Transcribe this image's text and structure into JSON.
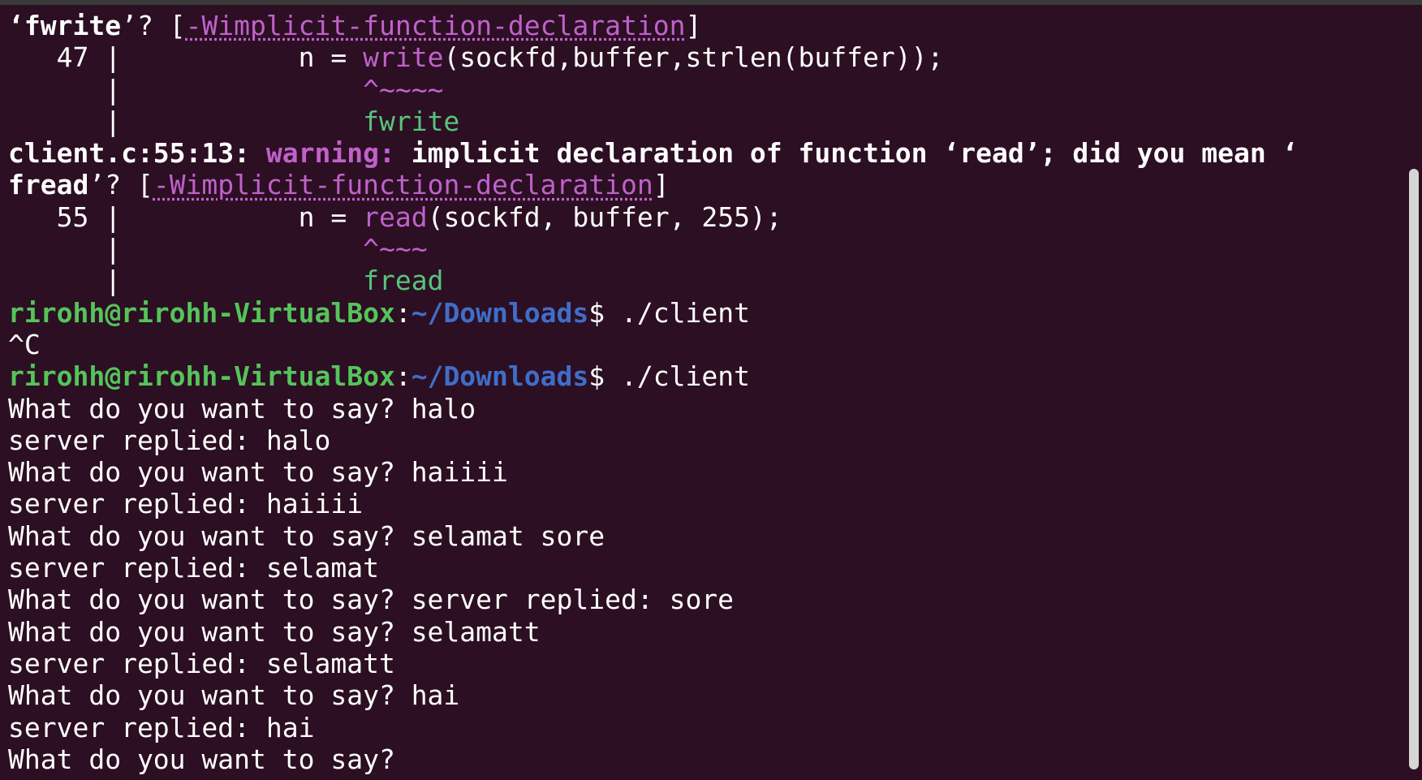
{
  "terminal": {
    "colors": {
      "background": "#2c0f23",
      "warning": "#c061cb",
      "suggestion": "#57c47a",
      "prompt_user": "#55c45a",
      "prompt_path": "#3f6ec9"
    },
    "line1": {
      "q_open": "‘",
      "func": "fwrite",
      "q_close": "’? [",
      "flag": "-Wimplicit-function-declaration",
      "bracket": "]"
    },
    "line2": {
      "gutter": "   47 |           n = ",
      "func": "write",
      "rest": "(sockfd,buffer,strlen(buffer));"
    },
    "line3": {
      "gutter": "      |               ",
      "caret": "^~~~~"
    },
    "line4": {
      "gutter": "      |               ",
      "hint": "fwrite"
    },
    "line5": {
      "loc": "client.c:55:13:",
      "sp1": " ",
      "kind": "warning:",
      "msg": " implicit declaration of function ",
      "q_open": "‘",
      "func": "read",
      "tail": "’; did you mean ‘"
    },
    "line6": {
      "func": "fread",
      "q_close": "’? [",
      "flag": "-Wimplicit-function-declaration",
      "bracket": "]"
    },
    "line7": {
      "gutter": "   55 |           n = ",
      "func": "read",
      "rest": "(sockfd, buffer, 255);"
    },
    "line8": {
      "gutter": "      |               ",
      "caret": "^~~~"
    },
    "line9": {
      "gutter": "      |               ",
      "hint": "fread"
    },
    "prompt": {
      "user_host": "rirohh@rirohh-VirtualBox",
      "colon": ":",
      "path": "~/Downloads",
      "dollar": "$ "
    },
    "cmd1": "./client",
    "interrupt": "^C",
    "cmd2": "./client",
    "session": [
      "What do you want to say? halo",
      "server replied: halo",
      "What do you want to say? haiiii",
      "server replied: haiiii",
      "What do you want to say? selamat sore",
      "server replied: selamat",
      "What do you want to say? server replied: sore",
      "What do you want to say? selamatt",
      "server replied: selamatt",
      "What do you want to say? hai",
      "server replied: hai",
      "What do you want to say?"
    ]
  }
}
